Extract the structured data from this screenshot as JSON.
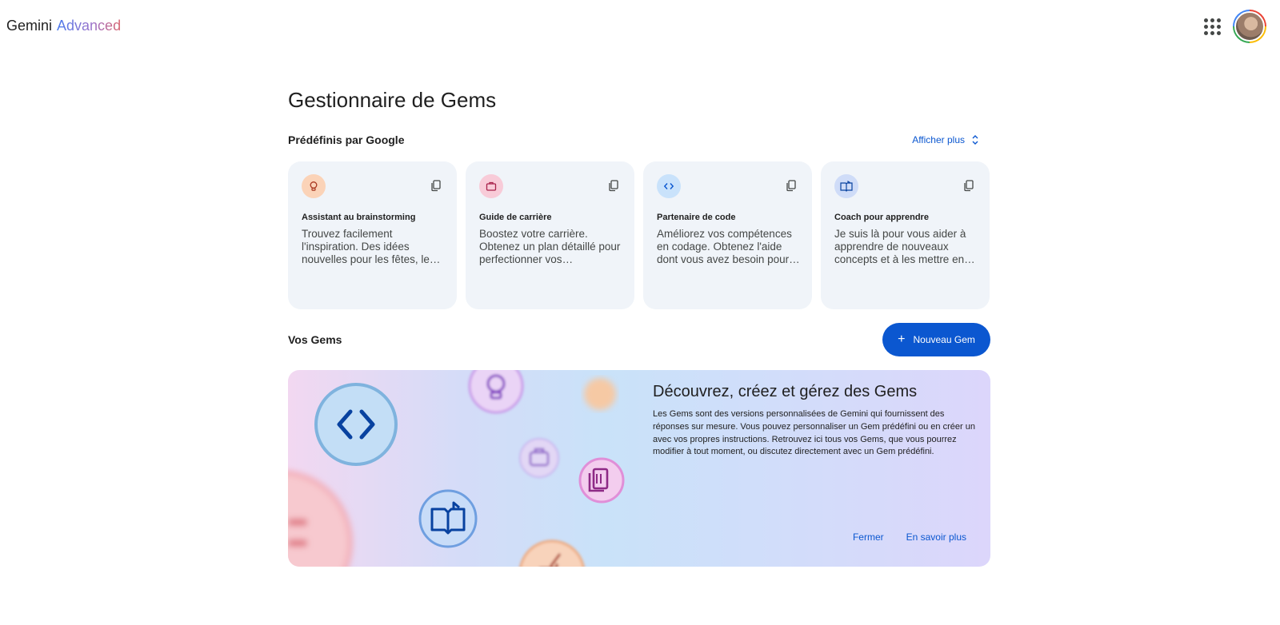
{
  "header": {
    "brand_primary": "Gemini",
    "brand_secondary": "Advanced",
    "apps_icon": "apps-grid-icon",
    "avatar_icon": "account-avatar"
  },
  "page": {
    "title": "Gestionnaire de Gems"
  },
  "predefined": {
    "title": "Prédéfinis par Google",
    "show_more": "Afficher plus",
    "cards": [
      {
        "name": "Assistant au brainstorming",
        "desc": "Trouvez facilement l'inspiration. Des idées nouvelles pour les fêtes, les cadeaux et bien plus encore.",
        "icon": "lightbulb-icon",
        "accent": "#fbd3b8"
      },
      {
        "name": "Guide de carrière",
        "desc": "Boostez votre carrière. Obtenez un plan détaillé pour perfectionner vos compétences.",
        "icon": "briefcase-icon",
        "accent": "#f8cbd8"
      },
      {
        "name": "Partenaire de code",
        "desc": "Améliorez vos compétences en codage. Obtenez l'aide dont vous avez besoin pour créer vos projets.",
        "icon": "code-icon",
        "accent": "#c9e2fb"
      },
      {
        "name": "Coach pour apprendre",
        "desc": "Je suis là pour vous aider à apprendre de nouveaux concepts et à les mettre en pratique.",
        "icon": "book-icon",
        "accent": "#cfdcf8"
      }
    ]
  },
  "your_gems": {
    "title": "Vos Gems",
    "new_gem_label": "Nouveau Gem"
  },
  "banner": {
    "title": "Découvrez, créez et gérez des Gems",
    "text": "Les Gems sont des versions personnalisées de Gemini qui fournissent des réponses sur mesure. Vous pouvez personnaliser un Gem prédéfini ou en créer un avec vos propres instructions. Retrouvez ici tous vos Gems, que vous pourrez modifier à tout moment, ou discutez directement avec un Gem prédéfini.",
    "close_label": "Fermer",
    "learn_more_label": "En savoir plus"
  }
}
